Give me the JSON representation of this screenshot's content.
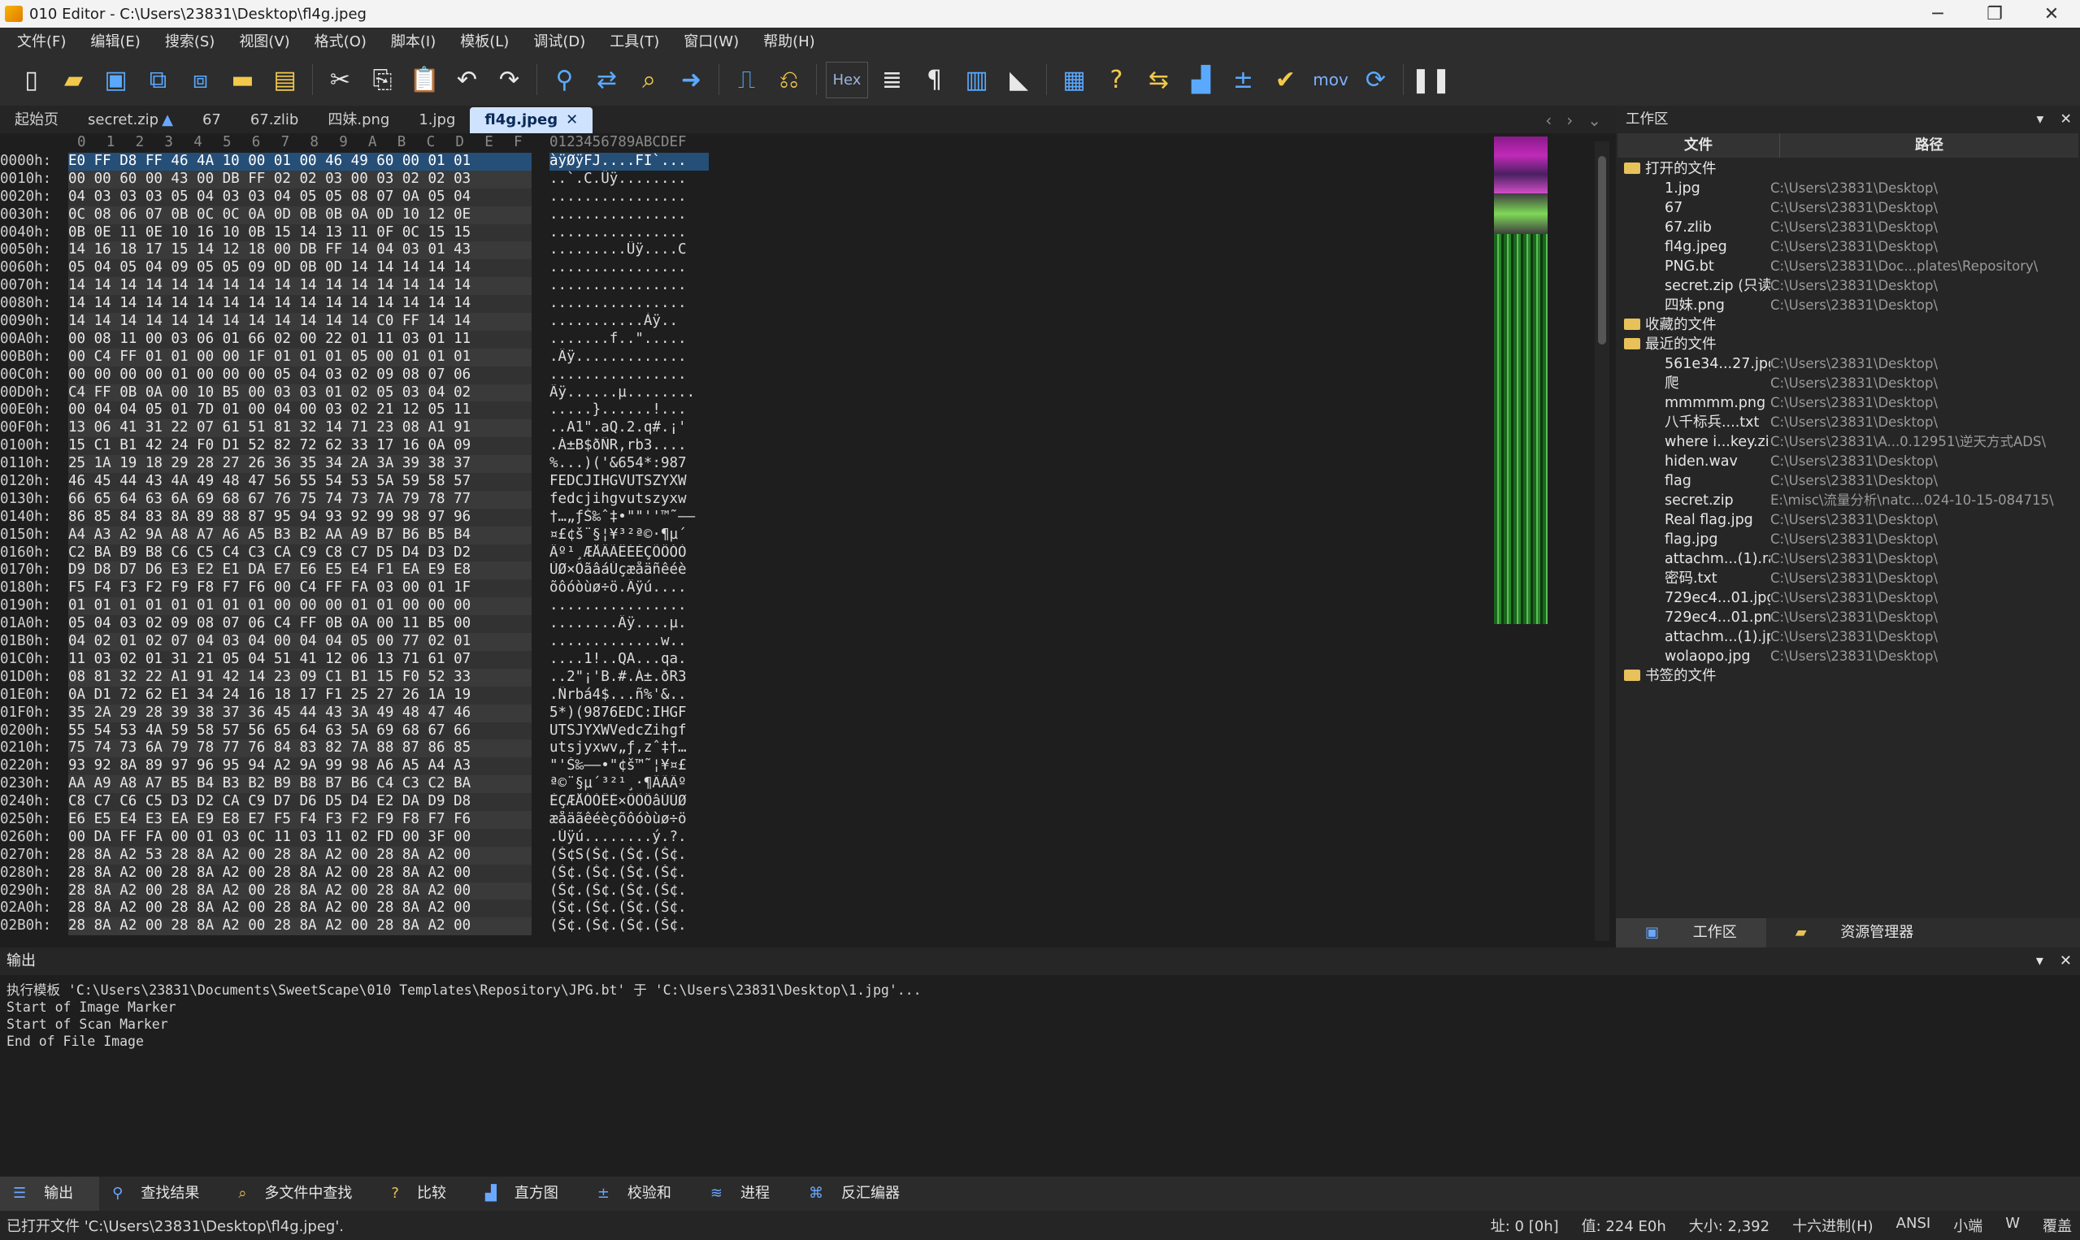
{
  "window": {
    "title": "010 Editor - C:\\Users\\23831\\Desktop\\fl4g.jpeg"
  },
  "menu": [
    "文件(F)",
    "编辑(E)",
    "搜索(S)",
    "视图(V)",
    "格式(O)",
    "脚本(I)",
    "模板(L)",
    "调试(D)",
    "工具(T)",
    "窗口(W)",
    "帮助(H)"
  ],
  "toolbar": {
    "hex_label": "Hex",
    "mov_label": "mov"
  },
  "tabs": [
    "起始页",
    "secret.zip",
    "67",
    "67.zlib",
    "四妹.png",
    "1.jpg",
    "fl4g.jpeg"
  ],
  "editor": {
    "hex_columns": [
      "0",
      "1",
      "2",
      "3",
      "4",
      "5",
      "6",
      "7",
      "8",
      "9",
      "A",
      "B",
      "C",
      "D",
      "E",
      "F"
    ],
    "ascii_header": "0123456789ABCDEF",
    "rows": [
      {
        "a": "0000h:",
        "h": "E0 FF D8 FF 46 4A 10 00 01 00 46 49 60 00 01 01",
        "t": "àÿØÿFJ....FI`..."
      },
      {
        "a": "0010h:",
        "h": "00 00 60 00 43 00 DB FF 02 02 03 00 03 02 02 03",
        "t": "..`.C.Ûÿ........"
      },
      {
        "a": "0020h:",
        "h": "04 03 03 03 05 04 03 03 04 05 05 08 07 0A 05 04",
        "t": "................"
      },
      {
        "a": "0030h:",
        "h": "0C 08 06 07 0B 0C 0C 0A 0D 0B 0B 0A 0D 10 12 0E",
        "t": "................"
      },
      {
        "a": "0040h:",
        "h": "0B 0E 11 0E 10 16 10 0B 15 14 13 11 0F 0C 15 15",
        "t": "................"
      },
      {
        "a": "0050h:",
        "h": "14 16 18 17 15 14 12 18 00 DB FF 14 04 03 01 43",
        "t": ".........Ûÿ....C"
      },
      {
        "a": "0060h:",
        "h": "05 04 05 04 09 05 05 09 0D 0B 0D 14 14 14 14 14",
        "t": "................"
      },
      {
        "a": "0070h:",
        "h": "14 14 14 14 14 14 14 14 14 14 14 14 14 14 14 14",
        "t": "................"
      },
      {
        "a": "0080h:",
        "h": "14 14 14 14 14 14 14 14 14 14 14 14 14 14 14 14",
        "t": "................"
      },
      {
        "a": "0090h:",
        "h": "14 14 14 14 14 14 14 14 14 14 14 14 C0 FF 14 14",
        "t": "...........Àÿ.."
      },
      {
        "a": "00A0h:",
        "h": "00 08 11 00 03 06 01 66 02 00 22 01 11 03 01 11",
        "t": ".......f..\"....."
      },
      {
        "a": "00B0h:",
        "h": "00 C4 FF 01 01 00 00 1F 01 01 01 05 00 01 01 01",
        "t": ".Äÿ............."
      },
      {
        "a": "00C0h:",
        "h": "00 00 00 00 01 00 00 00 05 04 03 02 09 08 07 06",
        "t": "................"
      },
      {
        "a": "00D0h:",
        "h": "C4 FF 0B 0A 00 10 B5 00 03 03 01 02 05 03 04 02",
        "t": "Äÿ......µ........"
      },
      {
        "a": "00E0h:",
        "h": "00 04 04 05 01 7D 01 00 04 00 03 02 21 12 05 11",
        "t": ".....}......!..."
      },
      {
        "a": "00F0h:",
        "h": "13 06 41 31 22 07 61 51 81 32 14 71 23 08 A1 91",
        "t": "..A1\".aQ.2.q#.¡'"
      },
      {
        "a": "0100h:",
        "h": "15 C1 B1 42 24 F0 D1 52 82 72 62 33 17 16 0A 09",
        "t": ".Á±B$ðÑR,rb3...."
      },
      {
        "a": "0110h:",
        "h": "25 1A 19 18 29 28 27 26 36 35 34 2A 3A 39 38 37",
        "t": "%...)('&654*:987"
      },
      {
        "a": "0120h:",
        "h": "46 45 44 43 4A 49 48 47 56 55 54 53 5A 59 58 57",
        "t": "FEDCJIHGVUTSZYXW"
      },
      {
        "a": "0130h:",
        "h": "66 65 64 63 6A 69 68 67 76 75 74 73 7A 79 78 77",
        "t": "fedcjihgvutszyxw"
      },
      {
        "a": "0140h:",
        "h": "86 85 84 83 8A 89 88 87 95 94 93 92 99 98 97 96",
        "t": "†…„ƒŠ‰ˆ‡•\"\"''™˜—–"
      },
      {
        "a": "0150h:",
        "h": "A4 A3 A2 9A A8 A7 A6 A5 B3 B2 AA A9 B7 B6 B5 B4",
        "t": "¤£¢š¨§¦¥³²ª©·¶µ´"
      },
      {
        "a": "0160h:",
        "h": "C2 BA B9 B8 C6 C5 C4 C3 CA C9 C8 C7 D5 D4 D3 D2",
        "t": "Âº¹¸ÆÅÄÃÊÉÈÇÕÔÓÒ"
      },
      {
        "a": "0170h:",
        "h": "D9 D8 D7 D6 E3 E2 E1 DA E7 E6 E5 E4 F1 EA E9 E8",
        "t": "ÙØ×ÖãâáÚçæåäñêéè"
      },
      {
        "a": "0180h:",
        "h": "F5 F4 F3 F2 F9 F8 F7 F6 00 C4 FF FA 03 00 01 1F",
        "t": "õôóòùø÷ö.Äÿú...."
      },
      {
        "a": "0190h:",
        "h": "01 01 01 01 01 01 01 01 00 00 00 01 01 00 00 00",
        "t": "................"
      },
      {
        "a": "01A0h:",
        "h": "05 04 03 02 09 08 07 06 C4 FF 0B 0A 00 11 B5 00",
        "t": "........Äÿ....µ."
      },
      {
        "a": "01B0h:",
        "h": "04 02 01 02 07 04 03 04 00 04 04 05 00 77 02 01",
        "t": ".............w.."
      },
      {
        "a": "01C0h:",
        "h": "11 03 02 01 31 21 05 04 51 41 12 06 13 71 61 07",
        "t": "....1!..QA...qa."
      },
      {
        "a": "01D0h:",
        "h": "08 81 32 22 A1 91 42 14 23 09 C1 B1 15 F0 52 33",
        "t": "..2\"¡'B.#.Á±.ðR3"
      },
      {
        "a": "01E0h:",
        "h": "0A D1 72 62 E1 34 24 16 18 17 F1 25 27 26 1A 19",
        "t": ".Ñrbá4$...ñ%'&.."
      },
      {
        "a": "01F0h:",
        "h": "35 2A 29 28 39 38 37 36 45 44 43 3A 49 48 47 46",
        "t": "5*)(9876EDC:IHGF"
      },
      {
        "a": "0200h:",
        "h": "55 54 53 4A 59 58 57 56 65 64 63 5A 69 68 67 66",
        "t": "UTSJYXWVedcZihgf"
      },
      {
        "a": "0210h:",
        "h": "75 74 73 6A 79 78 77 76 84 83 82 7A 88 87 86 85",
        "t": "utsjyxwv„ƒ‚zˆ‡†…"
      },
      {
        "a": "0220h:",
        "h": "93 92 8A 89 97 96 95 94 A2 9A 99 98 A6 A5 A4 A3",
        "t": "\"'Š‰—–•\"¢š™˜¦¥¤£"
      },
      {
        "a": "0230h:",
        "h": "AA A9 A8 A7 B5 B4 B3 B2 B9 B8 B7 B6 C4 C3 C2 BA",
        "t": "ª©¨§µ´³²¹¸·¶ÄÃÂº"
      },
      {
        "a": "0240h:",
        "h": "C8 C7 C6 C5 D3 D2 CA C9 D7 D6 D5 D4 E2 DA D9 D8",
        "t": "ÈÇÆÅÓÒÊÉ×ÖÕÔâÚÙØ"
      },
      {
        "a": "0250h:",
        "h": "E6 E5 E4 E3 EA E9 E8 E7 F5 F4 F3 F2 F9 F8 F7 F6",
        "t": "æåäãêéèçõôóòùø÷ö"
      },
      {
        "a": "0260h:",
        "h": "00 DA FF FA 00 01 03 0C 11 03 11 02 FD 00 3F 00",
        "t": ".Úÿú........ý.?."
      },
      {
        "a": "0270h:",
        "h": "28 8A A2 53 28 8A A2 00 28 8A A2 00 28 8A A2 00",
        "t": "(Š¢S(Š¢.(Š¢.(Š¢."
      },
      {
        "a": "0280h:",
        "h": "28 8A A2 00 28 8A A2 00 28 8A A2 00 28 8A A2 00",
        "t": "(Š¢.(Š¢.(Š¢.(Š¢."
      },
      {
        "a": "0290h:",
        "h": "28 8A A2 00 28 8A A2 00 28 8A A2 00 28 8A A2 00",
        "t": "(Š¢.(Š¢.(Š¢.(Š¢."
      },
      {
        "a": "02A0h:",
        "h": "28 8A A2 00 28 8A A2 00 28 8A A2 00 28 8A A2 00",
        "t": "(Š¢.(Š¢.(Š¢.(Š¢."
      },
      {
        "a": "02B0h:",
        "h": "28 8A A2 00 28 8A A2 00 28 8A A2 00 28 8A A2 00",
        "t": "(Š¢.(Š¢.(Š¢.(Š¢."
      }
    ]
  },
  "workspace": {
    "title": "工作区",
    "col_file": "文件",
    "col_path": "路径",
    "open_group": "打开的文件",
    "open_files": [
      {
        "n": "1.jpg",
        "p": "C:\\Users\\23831\\Desktop\\"
      },
      {
        "n": "67",
        "p": "C:\\Users\\23831\\Desktop\\"
      },
      {
        "n": "67.zlib",
        "p": "C:\\Users\\23831\\Desktop\\"
      },
      {
        "n": "fl4g.jpeg",
        "p": "C:\\Users\\23831\\Desktop\\"
      },
      {
        "n": "PNG.bt",
        "p": "C:\\Users\\23831\\Doc...plates\\Repository\\"
      },
      {
        "n": "secret.zip (只读)",
        "p": "C:\\Users\\23831\\Desktop\\"
      },
      {
        "n": "四妹.png",
        "p": "C:\\Users\\23831\\Desktop\\"
      }
    ],
    "fav_group": "收藏的文件",
    "recent_group": "最近的文件",
    "recent_files": [
      {
        "n": "561e34...27.jpg",
        "p": "C:\\Users\\23831\\Desktop\\"
      },
      {
        "n": "爬",
        "p": "C:\\Users\\23831\\Desktop\\"
      },
      {
        "n": "mmmmm.png",
        "p": "C:\\Users\\23831\\Desktop\\"
      },
      {
        "n": "八千标兵....txt",
        "p": "C:\\Users\\23831\\Desktop\\"
      },
      {
        "n": "where i...key.zip",
        "p": "C:\\Users\\23831\\A...0.12951\\逆天方式ADS\\"
      },
      {
        "n": "hiden.wav",
        "p": "C:\\Users\\23831\\Desktop\\"
      },
      {
        "n": "flag",
        "p": "C:\\Users\\23831\\Desktop\\"
      },
      {
        "n": "secret.zip",
        "p": "E:\\misc\\流量分析\\natc...024-10-15-084715\\"
      },
      {
        "n": "Real flag.jpg",
        "p": "C:\\Users\\23831\\Desktop\\"
      },
      {
        "n": "flag.jpg",
        "p": "C:\\Users\\23831\\Desktop\\"
      },
      {
        "n": "attachm...(1).rar",
        "p": "C:\\Users\\23831\\Desktop\\"
      },
      {
        "n": "密码.txt",
        "p": "C:\\Users\\23831\\Desktop\\"
      },
      {
        "n": "729ec4...01.jpg",
        "p": "C:\\Users\\23831\\Desktop\\"
      },
      {
        "n": "729ec4...01.png",
        "p": "C:\\Users\\23831\\Desktop\\"
      },
      {
        "n": "attachm...(1).jpg",
        "p": "C:\\Users\\23831\\Desktop\\"
      },
      {
        "n": "wolaopo.jpg",
        "p": "C:\\Users\\23831\\Desktop\\"
      }
    ],
    "bookmark_group": "书签的文件",
    "tab_workspace": "工作区",
    "tab_explorer": "资源管理器"
  },
  "output": {
    "title": "输出",
    "lines": [
      "执行模板 'C:\\Users\\23831\\Documents\\SweetScape\\010 Templates\\Repository\\JPG.bt' 于 'C:\\Users\\23831\\Desktop\\1.jpg'...",
      "Start of Image Marker",
      "Start of Scan Marker",
      "End of File Image"
    ]
  },
  "bottom_tabs": [
    "输出",
    "查找结果",
    "多文件中查找",
    "比较",
    "直方图",
    "校验和",
    "进程",
    "反汇编器"
  ],
  "status": {
    "message": "已打开文件 'C:\\Users\\23831\\Desktop\\fl4g.jpeg'.",
    "address": "址: 0 [0h]",
    "value": "值: 224 E0h",
    "size": "大小: 2,392",
    "mode": "十六进制(H)",
    "encoding": "ANSI",
    "endian": "小端",
    "w": "W",
    "overwrite": "覆盖"
  }
}
